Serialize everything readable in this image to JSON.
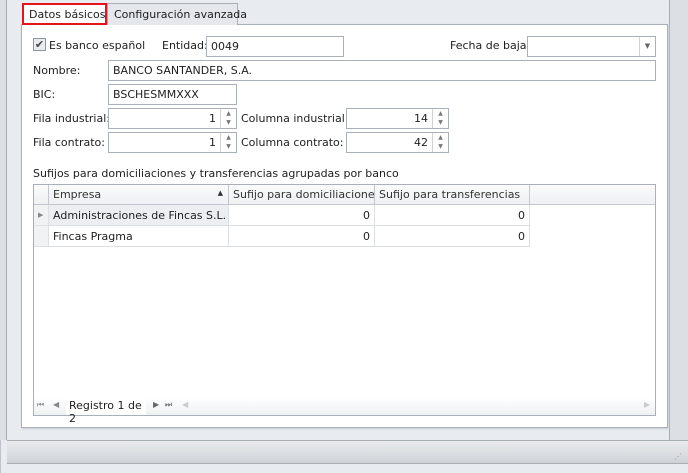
{
  "tabs": [
    {
      "label": "Datos básicos",
      "active": true
    },
    {
      "label": "Configuración avanzada",
      "active": false
    }
  ],
  "form": {
    "es_banco_espanol": {
      "label": "Es banco español",
      "checked": true
    },
    "entidad": {
      "label": "Entidad:",
      "value": "0049"
    },
    "fecha_baja": {
      "label": "Fecha de baja:",
      "value": ""
    },
    "nombre": {
      "label": "Nombre:",
      "value": "BANCO SANTANDER, S.A."
    },
    "bic": {
      "label": "BIC:",
      "value": "BSCHESMMXXX"
    },
    "fila_industrial": {
      "label": "Fila industrial:",
      "value": "1"
    },
    "columna_industrial": {
      "label": "Columna industrial:",
      "value": "14"
    },
    "fila_contrato": {
      "label": "Fila contrato:",
      "value": "1"
    },
    "columna_contrato": {
      "label": "Columna contrato:",
      "value": "42"
    }
  },
  "grid": {
    "title": "Sufijos para domiciliaciones y transferencias agrupadas por banco",
    "columns": [
      "Empresa",
      "Sufijo para domiciliaciones",
      "Sufijo para transferencias"
    ],
    "rows": [
      [
        "Administraciones de Fincas S.L.",
        "0",
        "0"
      ],
      [
        "Fincas Pragma",
        "0",
        "0"
      ]
    ],
    "navigator": "Registro 1 de 2"
  },
  "accent": "#e3141b"
}
